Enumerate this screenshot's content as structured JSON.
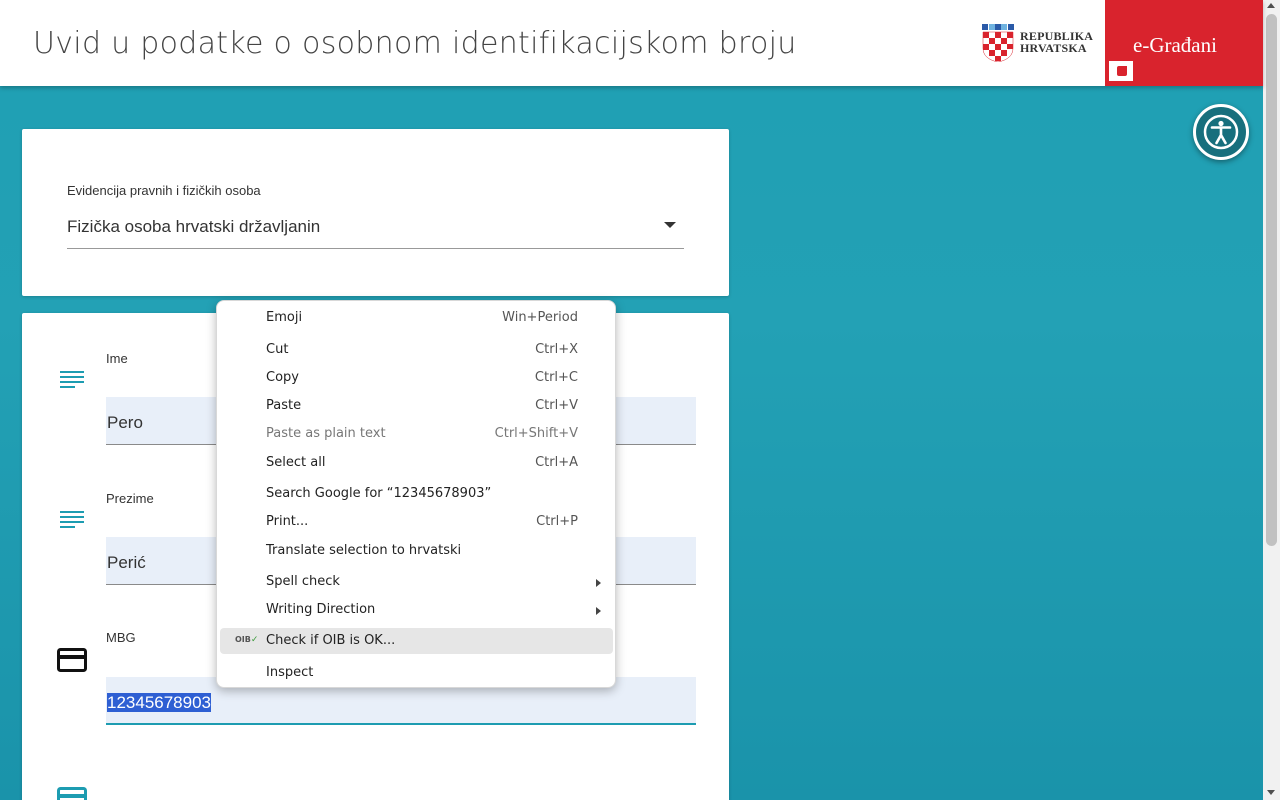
{
  "header": {
    "title": "Uvid u podatke o osobnom identifikacijskom broju",
    "logo_line1": "REPUBLIKA",
    "logo_line2": "HRVATSKA",
    "portal": "e-Građani"
  },
  "selector": {
    "label": "Evidencija pravnih i fizičkih osoba",
    "value": "Fizička osoba hrvatski državljanin"
  },
  "fields": {
    "ime": {
      "label": "Ime",
      "value": "Pero"
    },
    "prezime": {
      "label": "Prezime",
      "value": "Perić"
    },
    "mbg": {
      "label": "MBG",
      "value": "12345678903"
    }
  },
  "context_menu": {
    "items": [
      {
        "label": "Emoji",
        "shortcut": "Win+Period"
      },
      {
        "label": "Cut",
        "shortcut": "Ctrl+X"
      },
      {
        "label": "Copy",
        "shortcut": "Ctrl+C"
      },
      {
        "label": "Paste",
        "shortcut": "Ctrl+V"
      },
      {
        "label": "Paste as plain text",
        "shortcut": "Ctrl+Shift+V",
        "disabled": true
      },
      {
        "label": "Select all",
        "shortcut": "Ctrl+A"
      },
      {
        "label": "Search Google for “12345678903”",
        "shortcut": ""
      },
      {
        "label": "Print...",
        "shortcut": "Ctrl+P"
      },
      {
        "label": "Translate selection to hrvatski",
        "shortcut": ""
      },
      {
        "label": "Spell check",
        "submenu": true
      },
      {
        "label": "Writing Direction",
        "submenu": true
      },
      {
        "label": "Check if OIB is OK...",
        "highlighted": true,
        "icon": "OIB"
      },
      {
        "label": "Inspect",
        "shortcut": ""
      }
    ]
  },
  "colors": {
    "background": "#1f9fb3",
    "accent_red": "#d9232d",
    "selection": "#2e5fd3",
    "field_bg": "#e8eff9"
  },
  "icons": [
    "text-lines-icon",
    "card-icon",
    "accessibility-icon"
  ]
}
